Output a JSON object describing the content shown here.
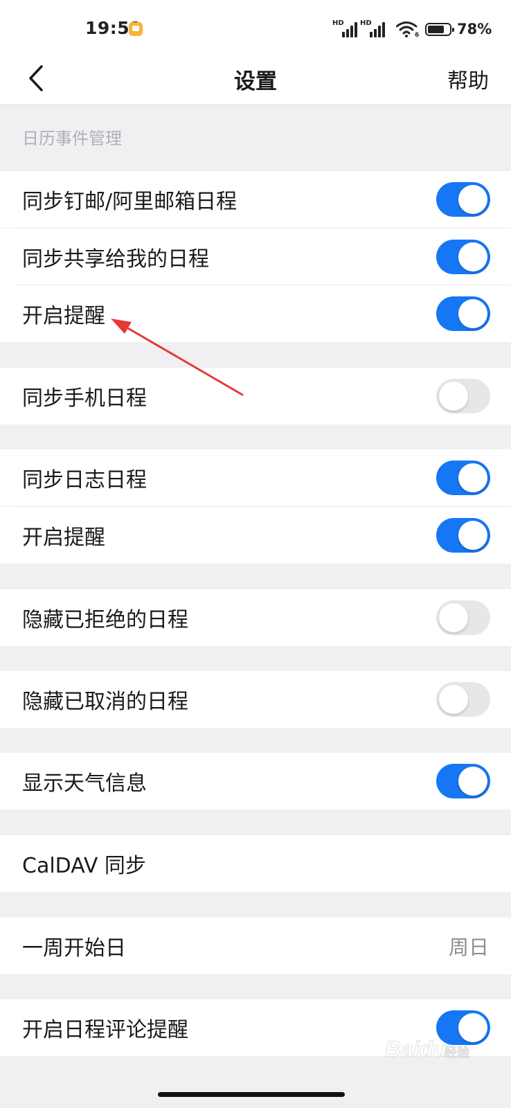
{
  "status": {
    "time": "19:51",
    "signal1_label": "HD",
    "signal2_label": "HD",
    "wifi_label": "6",
    "battery_text": "78%",
    "battery_level": 0.78
  },
  "nav": {
    "title": "设置",
    "help_label": "帮助"
  },
  "section": {
    "header": "日历事件管理"
  },
  "rows": [
    {
      "label": "同步钉邮/阿里邮箱日程",
      "toggle": "on"
    },
    {
      "label": "同步共享给我的日程",
      "toggle": "on"
    },
    {
      "label": "开启提醒",
      "toggle": "on"
    },
    {
      "label": "同步手机日程",
      "toggle": "off"
    },
    {
      "label": "同步日志日程",
      "toggle": "on"
    },
    {
      "label": "开启提醒",
      "toggle": "on"
    },
    {
      "label": "隐藏已拒绝的日程",
      "toggle": "off"
    },
    {
      "label": "隐藏已取消的日程",
      "toggle": "off"
    },
    {
      "label": "显示天气信息",
      "toggle": "on"
    },
    {
      "label": "CalDAV 同步"
    },
    {
      "label": "一周开始日",
      "value": "周日"
    },
    {
      "label": "开启日程评论提醒",
      "toggle": "on"
    }
  ],
  "watermark": {
    "text": "Baidu",
    "subtext": "经验"
  },
  "colors": {
    "toggle_on": "#1677f5",
    "toggle_off": "#e7e7ea",
    "background": "#f0f0f3",
    "arrow": "#e53935"
  }
}
